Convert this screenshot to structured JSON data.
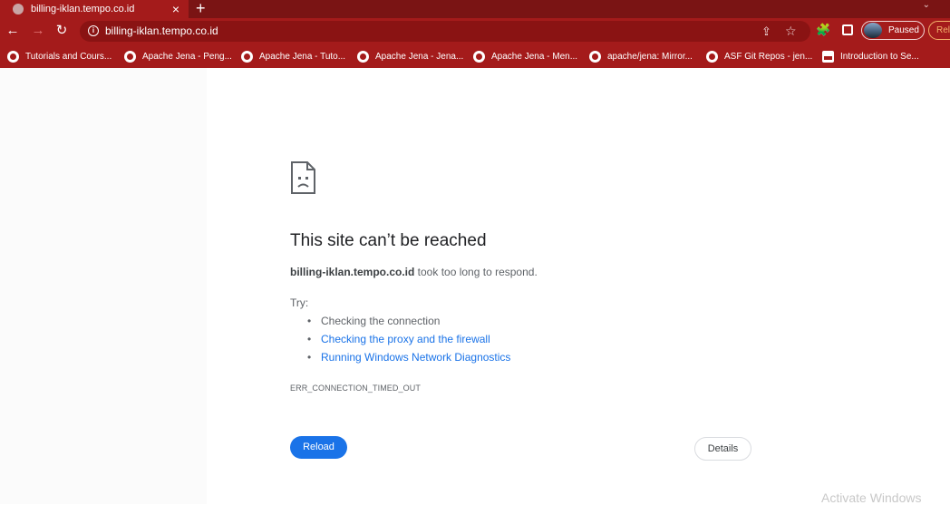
{
  "tab": {
    "title": "billing-iklan.tempo.co.id",
    "close": "×",
    "new_tab": "+",
    "menu": "⌄"
  },
  "toolbar": {
    "back": "←",
    "forward": "→",
    "reload": "↻",
    "url": "billing-iklan.tempo.co.id",
    "profile_label": "Paused",
    "relaunch_label": "Rel"
  },
  "icons": {
    "info": "i",
    "share": "⇪",
    "star": "☆",
    "extensions": "🧩"
  },
  "bookmarks": [
    "Tutorials and Cours...",
    "Apache Jena - Peng...",
    "Apache Jena - Tuto...",
    "Apache Jena - Jena...",
    "Apache Jena - Men...",
    "apache/jena: Mirror...",
    "ASF Git Repos - jen...",
    "Introduction to Se..."
  ],
  "error_page": {
    "title": "This site can’t be reached",
    "host": "billing-iklan.tempo.co.id",
    "message": " took too long to respond.",
    "try_label": "Try:",
    "suggestions": [
      "Checking the connection",
      "Checking the proxy and the firewall",
      "Running Windows Network Diagnostics"
    ],
    "error_code": "ERR_CONNECTION_TIMED_OUT",
    "reload_label": "Reload",
    "details_label": "Details"
  },
  "watermark": "Activate Windows",
  "colors": {
    "theme_red": "#a41b1b",
    "link_blue": "#1a73e8",
    "relaunch_orange": "#f3b16a"
  }
}
